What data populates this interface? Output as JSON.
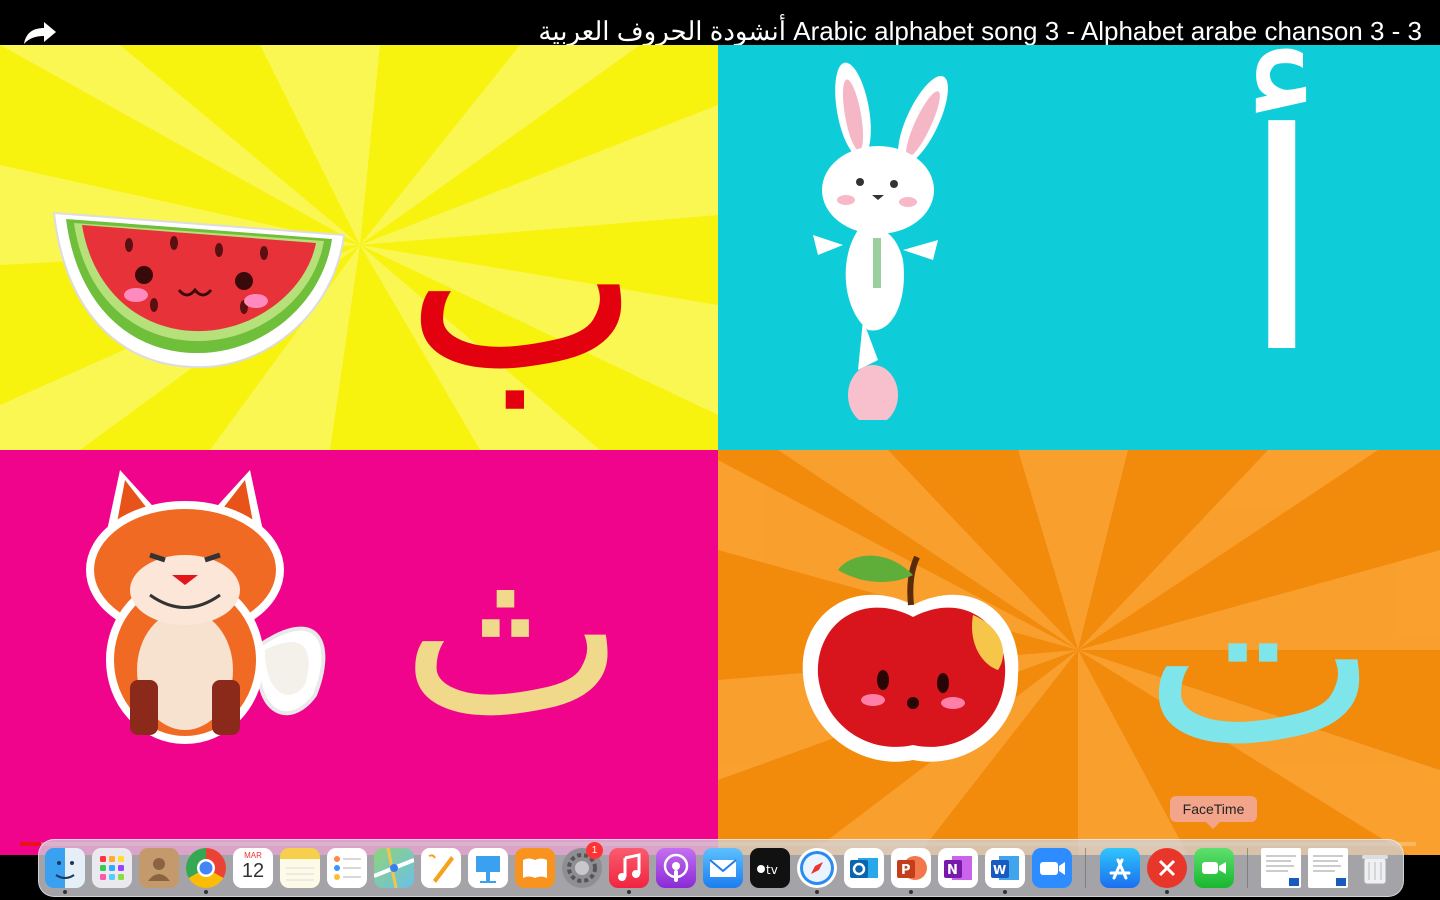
{
  "video": {
    "title": "أنشودة الحروف العربية Arabic alphabet song 3 - Alphabet arabe chanson 3 - 3",
    "progress_fraction": 0.015,
    "panels": [
      {
        "letter": "ب",
        "picture": "watermelon",
        "background": "#f7f20e",
        "letter_color": "#e3000f"
      },
      {
        "letter": "أ",
        "picture": "rabbit",
        "background": "#0ecdd8",
        "letter_color": "#ffffff"
      },
      {
        "letter": "ث",
        "picture": "fox",
        "background": "#f0048c",
        "letter_color": "#f0d98a"
      },
      {
        "letter": "ت",
        "picture": "apple",
        "background": "#f28a0c",
        "letter_color": "#7ee6ea"
      }
    ]
  },
  "calendar_icon": {
    "month": "MAR",
    "day": "12"
  },
  "settings_badge": "1",
  "dock_tooltip": "FaceTime",
  "dock_items": [
    {
      "name": "finder",
      "running": true
    },
    {
      "name": "launchpad",
      "running": false
    },
    {
      "name": "contacts",
      "running": false
    },
    {
      "name": "chrome",
      "running": true
    },
    {
      "name": "calendar",
      "running": false
    },
    {
      "name": "notes",
      "running": false
    },
    {
      "name": "reminders",
      "running": false
    },
    {
      "name": "maps",
      "running": false
    },
    {
      "name": "pages",
      "running": false
    },
    {
      "name": "keynote",
      "running": false
    },
    {
      "name": "books",
      "running": false
    },
    {
      "name": "system-settings",
      "running": false
    },
    {
      "name": "music",
      "running": true
    },
    {
      "name": "podcasts",
      "running": false
    },
    {
      "name": "mail",
      "running": false
    },
    {
      "name": "apple-tv",
      "running": false
    },
    {
      "name": "safari",
      "running": true
    },
    {
      "name": "outlook",
      "running": false
    },
    {
      "name": "powerpoint",
      "running": true
    },
    {
      "name": "onenote",
      "running": false
    },
    {
      "name": "word",
      "running": true
    },
    {
      "name": "zoom",
      "running": false
    },
    {
      "name": "app-store",
      "running": false
    },
    {
      "name": "remote-desktop",
      "running": true
    },
    {
      "name": "facetime",
      "running": false
    },
    {
      "name": "document-thumbnail-1",
      "running": false
    },
    {
      "name": "document-thumbnail-2",
      "running": false
    },
    {
      "name": "trash",
      "running": false
    }
  ]
}
